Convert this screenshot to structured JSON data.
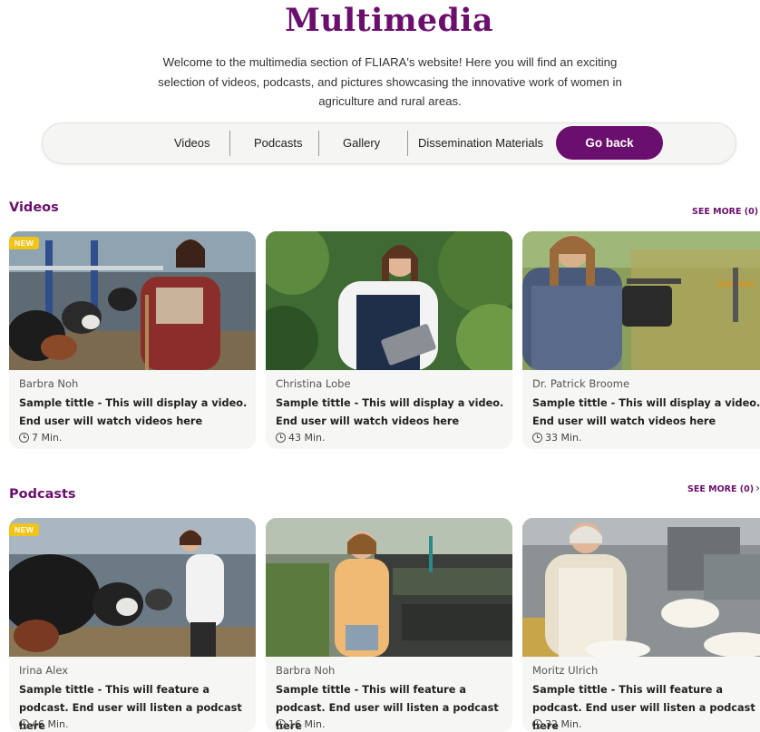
{
  "page": {
    "title": "Multimedia",
    "intro": "Welcome to the multimedia section of FLIARA's website! Here you will find an exciting selection of videos, podcasts, and pictures showcasing the innovative work of women in agriculture and rural areas."
  },
  "nav": {
    "items": [
      "Videos",
      "Podcasts",
      "Gallery",
      "Dissemination Materials"
    ],
    "go_back": "Go back"
  },
  "colors": {
    "brand": "#6b0f6e",
    "new_badge": "#f0c419",
    "card_bg": "#f6f6f4"
  },
  "sections": {
    "videos": {
      "heading": "Videos",
      "see_more": "SEE MORE (0)",
      "cards": [
        {
          "badge": "NEW",
          "author": "Barbra Noh",
          "title": "Sample tittle - This will display a video. End user will watch videos here",
          "duration": "7 Min.",
          "image": "woman in barn with cows"
        },
        {
          "badge": "",
          "author": "Christina Lobe",
          "title": "Sample tittle - This will display a video. End user will watch videos here",
          "duration": "43 Min.",
          "image": "woman in greenhouse with tablet"
        },
        {
          "badge": "",
          "author": "Dr. Patrick Broome",
          "title": "Sample tittle - This will display a video. End user will watch videos here",
          "duration": "33 Min.",
          "image": "woman flying drone over field"
        }
      ]
    },
    "podcasts": {
      "heading": "Podcasts",
      "see_more": "SEE MORE (0)",
      "cards": [
        {
          "badge": "NEW",
          "author": "Irina Alex",
          "title": "Sample tittle - This will feature a podcast. End user will listen a podcast here",
          "duration": "46 Min.",
          "image": "vet with cows in barn"
        },
        {
          "badge": "",
          "author": "Barbra Noh",
          "title": "Sample tittle - This will feature a podcast. End user will listen a podcast here",
          "duration": "16 Min.",
          "image": "woman in seedling greenhouse"
        },
        {
          "badge": "",
          "author": "Moritz Ulrich",
          "title": "Sample tittle - This will feature a podcast. End user will listen a podcast here",
          "duration": "32 Min.",
          "image": "woman making cheese"
        }
      ]
    }
  }
}
